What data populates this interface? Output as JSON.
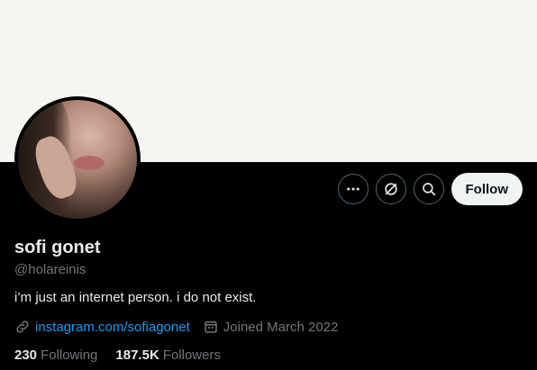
{
  "profile": {
    "display_name": "sofi gonet",
    "handle": "@holareinis",
    "bio": "i’m just an internet person. i do not exist.",
    "website": "instagram.com/sofiagonet",
    "joined": "Joined March 2022"
  },
  "stats": {
    "following_count": "230",
    "following_label": "Following",
    "followers_count": "187.5K",
    "followers_label": "Followers"
  },
  "actions": {
    "follow_label": "Follow",
    "more_icon": "more-icon",
    "grok_icon": "grok-icon",
    "search_icon": "search-icon"
  },
  "colors": {
    "background": "#000000",
    "banner": "#f7f5f0",
    "link": "#1d9bf0",
    "muted": "#71767b",
    "follow_button": "#eff3f4"
  }
}
